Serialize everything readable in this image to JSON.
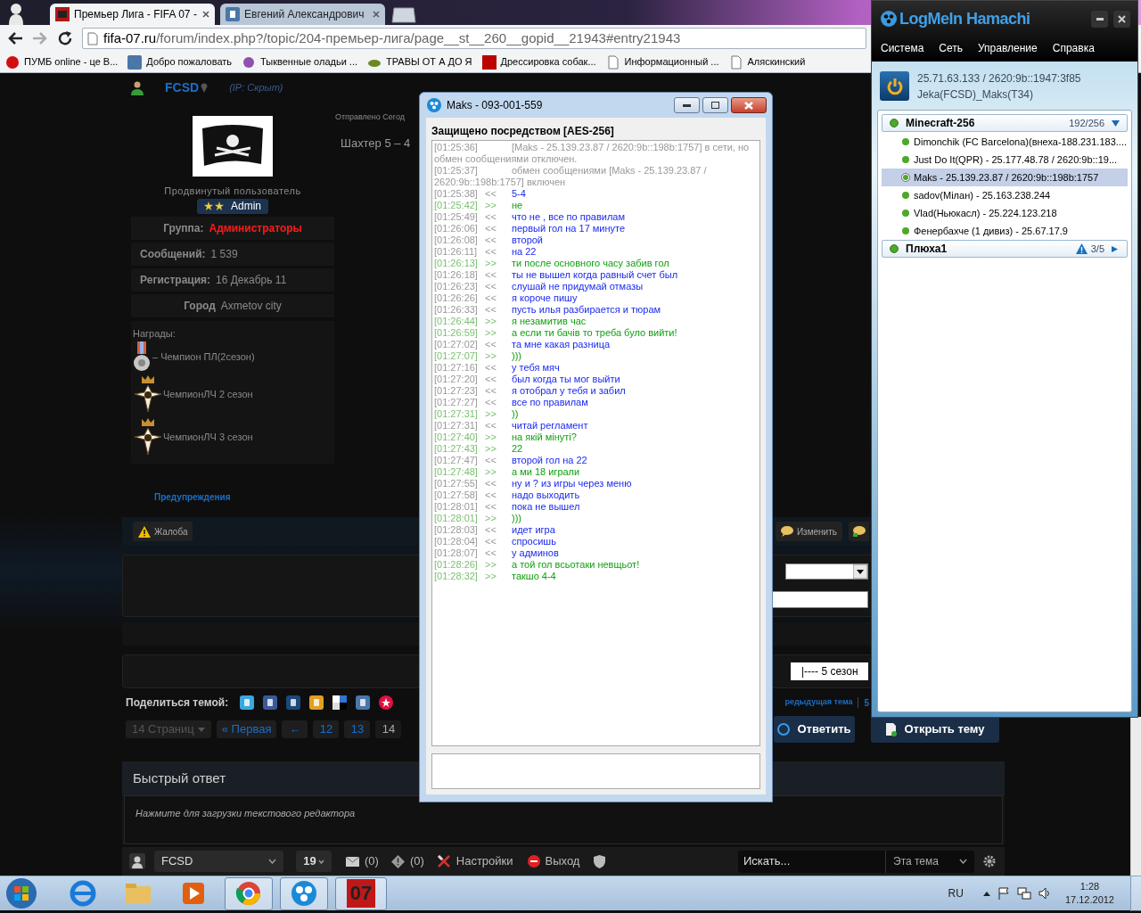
{
  "browser": {
    "tabs": [
      {
        "title": "Премьер Лига - FIFA 07 -",
        "selected": true
      },
      {
        "title": "Евгений Александрович",
        "selected": false
      }
    ],
    "address": {
      "host": "fifa-07.ru",
      "path": "/forum/index.php?/topic/204-премьер-лига/page__st__260__gopid__21943#entry21943"
    },
    "bookmarks": [
      "ПУМБ online - це В...",
      "Добро пожаловать",
      "Тыквенные оладьи ...",
      "ТРАВЫ ОТ А ДО Я",
      "Дрессировка собак...",
      "Информационный ...",
      "Аляскинский"
    ]
  },
  "post": {
    "author": "FCSD",
    "ip": "(IP: Скрыт)",
    "rank": "Продвинутый пользователь",
    "badge": {
      "label": "Admin"
    },
    "fields": [
      {
        "label": "Группа:",
        "value": "Администраторы",
        "kind": "group"
      },
      {
        "label": "Сообщений:",
        "value": "1 539",
        "kind": "plain"
      },
      {
        "label": "Регистрация:",
        "value": "16 Декабрь 11",
        "kind": "plain"
      },
      {
        "label": "Город",
        "value": "Axmetov city",
        "kind": "plain"
      }
    ],
    "awards_label": "Награды:",
    "awards": [
      {
        "label": "– Чемпион ПЛ(2сезон)",
        "kind": "medal"
      },
      {
        "label": "ЧемпионЛЧ 2 сезон",
        "kind": "cross"
      },
      {
        "label": "ЧемпионЛЧ 3 сезон",
        "kind": "cross"
      }
    ],
    "warnings_link": "Предупреждения",
    "sent": "Отправлено Сегод",
    "body": "Шахтер 5 – 4",
    "report_button": "Жалоба",
    "edit_button": "Изменить"
  },
  "season_select": "|---- 5 сезон",
  "share": {
    "label": "Поделиться темой:",
    "prev_topic": "редыдущая тема",
    "next": "5"
  },
  "pagination": {
    "pages": "14 Страниц",
    "first": "« Первая",
    "back": "←",
    "items": [
      {
        "label": "12",
        "selected": false
      },
      {
        "label": "13",
        "selected": false
      },
      {
        "label": "14",
        "selected": true
      }
    ]
  },
  "reply_button": "Ответить",
  "new_topic_button": "Открыть тему",
  "quick_reply": {
    "title": "Быстрый ответ",
    "hint": "Нажмите для загрузки текстового редактора"
  },
  "bottom_bar": {
    "user": "FCSD",
    "count": "19",
    "messages": "(0)",
    "reports": "(0)",
    "settings": "Настройки",
    "logout": "Выход",
    "search": {
      "placeholder": "Искать..."
    },
    "scope": "Эта тема"
  },
  "chat": {
    "title": "Maks - 093-001-559",
    "security": "Защищено посредством [AES-256]",
    "messages": [
      {
        "kind": "system",
        "time": "[01:25:36]",
        "text": "[Maks - 25.139.23.87 / 2620:9b::198b:1757] в сети, но обмен сообщениями отключен."
      },
      {
        "kind": "system",
        "time": "[01:25:37]",
        "text": "обмен сообщениями [Maks - 25.139.23.87 / 2620:9b::198b:1757] включен"
      },
      {
        "kind": "in",
        "time": "[01:25:38]",
        "arrow": "<<",
        "text": "5-4"
      },
      {
        "kind": "out",
        "time": "[01:25:42]",
        "arrow": ">>",
        "text": "не"
      },
      {
        "kind": "in",
        "time": "[01:25:49]",
        "arrow": "<<",
        "text": "что не , все по правилам"
      },
      {
        "kind": "in",
        "time": "[01:26:06]",
        "arrow": "<<",
        "text": "первый гол на 17 минуте"
      },
      {
        "kind": "in",
        "time": "[01:26:08]",
        "arrow": "<<",
        "text": "второй"
      },
      {
        "kind": "in",
        "time": "[01:26:11]",
        "arrow": "<<",
        "text": "на 22"
      },
      {
        "kind": "out",
        "time": "[01:26:13]",
        "arrow": ">>",
        "text": "ти после основного часу забив гол"
      },
      {
        "kind": "in",
        "time": "[01:26:18]",
        "arrow": "<<",
        "text": "ты не вышел когда равный счет был"
      },
      {
        "kind": "in",
        "time": "[01:26:23]",
        "arrow": "<<",
        "text": "слушай не придумай отмазы"
      },
      {
        "kind": "in",
        "time": "[01:26:26]",
        "arrow": "<<",
        "text": "я короче пишу"
      },
      {
        "kind": "in",
        "time": "[01:26:33]",
        "arrow": "<<",
        "text": "пусть илья разбирается и тюрам"
      },
      {
        "kind": "out",
        "time": "[01:26:44]",
        "arrow": ">>",
        "text": "я незамитив час"
      },
      {
        "kind": "out",
        "time": "[01:26:59]",
        "arrow": ">>",
        "text": "а если ти бачів то треба було вийти!"
      },
      {
        "kind": "in",
        "time": "[01:27:02]",
        "arrow": "<<",
        "text": "та мне какая разница"
      },
      {
        "kind": "out",
        "time": "[01:27:07]",
        "arrow": ">>",
        "text": ")))"
      },
      {
        "kind": "in",
        "time": "[01:27:16]",
        "arrow": "<<",
        "text": "у тебя мяч"
      },
      {
        "kind": "in",
        "time": "[01:27:20]",
        "arrow": "<<",
        "text": "был когда ты мог выйти"
      },
      {
        "kind": "in",
        "time": "[01:27:23]",
        "arrow": "<<",
        "text": "я отобрал у тебя и забил"
      },
      {
        "kind": "in",
        "time": "[01:27:27]",
        "arrow": "<<",
        "text": "все по правилам"
      },
      {
        "kind": "out",
        "time": "[01:27:31]",
        "arrow": ">>",
        "text": "))"
      },
      {
        "kind": "in",
        "time": "[01:27:31]",
        "arrow": "<<",
        "text": "читай регламент"
      },
      {
        "kind": "out",
        "time": "[01:27:40]",
        "arrow": ">>",
        "text": "на якій мінуті?"
      },
      {
        "kind": "out",
        "time": "[01:27:43]",
        "arrow": ">>",
        "text": "22"
      },
      {
        "kind": "in",
        "time": "[01:27:47]",
        "arrow": "<<",
        "text": "второй гол на 22"
      },
      {
        "kind": "out",
        "time": "[01:27:48]",
        "arrow": ">>",
        "text": "а ми 18 играли"
      },
      {
        "kind": "in",
        "time": "[01:27:55]",
        "arrow": "<<",
        "text": "ну и ? из игры через меню"
      },
      {
        "kind": "in",
        "time": "[01:27:58]",
        "arrow": "<<",
        "text": "надо выходить"
      },
      {
        "kind": "in",
        "time": "[01:28:01]",
        "arrow": "<<",
        "text": "пока не вышел"
      },
      {
        "kind": "out",
        "time": "[01:28:01]",
        "arrow": ">>",
        "text": ")))"
      },
      {
        "kind": "in",
        "time": "[01:28:03]",
        "arrow": "<<",
        "text": "идет игра"
      },
      {
        "kind": "in",
        "time": "[01:28:04]",
        "arrow": "<<",
        "text": "спросишь"
      },
      {
        "kind": "in",
        "time": "[01:28:07]",
        "arrow": "<<",
        "text": "у админов"
      },
      {
        "kind": "out",
        "time": "[01:28:26]",
        "arrow": ">>",
        "text": "а той гол всьотаки невщьот!"
      },
      {
        "kind": "out",
        "time": "[01:28:32]",
        "arrow": ">>",
        "text": "такшо 4-4"
      }
    ]
  },
  "hamachi": {
    "title": "LogMeIn Hamachi",
    "menu": [
      "Система",
      "Сеть",
      "Управление",
      "Справка"
    ],
    "address": "25.71.63.133 / 2620:9b::1947:3f85",
    "client": "Jeka(FCSD)_Maks(T34)",
    "networks": [
      {
        "name": "Minecraft-256",
        "count": "192/256",
        "warning": false,
        "expanded": true,
        "members": [
          {
            "label": "Dimonchik (FC Barcelona)(внеха-188.231.183....",
            "selected": false
          },
          {
            "label": "Just Do It(QPR) - 25.177.48.78 / 2620:9b::19...",
            "selected": false
          },
          {
            "label": "Maks - 25.139.23.87 / 2620:9b::198b:1757",
            "selected": true
          },
          {
            "label": "sadov(Мілан) - 25.163.238.244",
            "selected": false
          },
          {
            "label": "Vlad(Ньюкасл) - 25.224.123.218",
            "selected": false
          },
          {
            "label": "Фенербахче (1 дивиз) - 25.67.17.9",
            "selected": false
          }
        ]
      },
      {
        "name": "Плюха1",
        "count": "3/5",
        "warning": true,
        "expanded": false
      }
    ]
  },
  "taskbar": {
    "language": "RU",
    "time": "1:28",
    "date": "17.12.2012",
    "game_label": "07"
  }
}
